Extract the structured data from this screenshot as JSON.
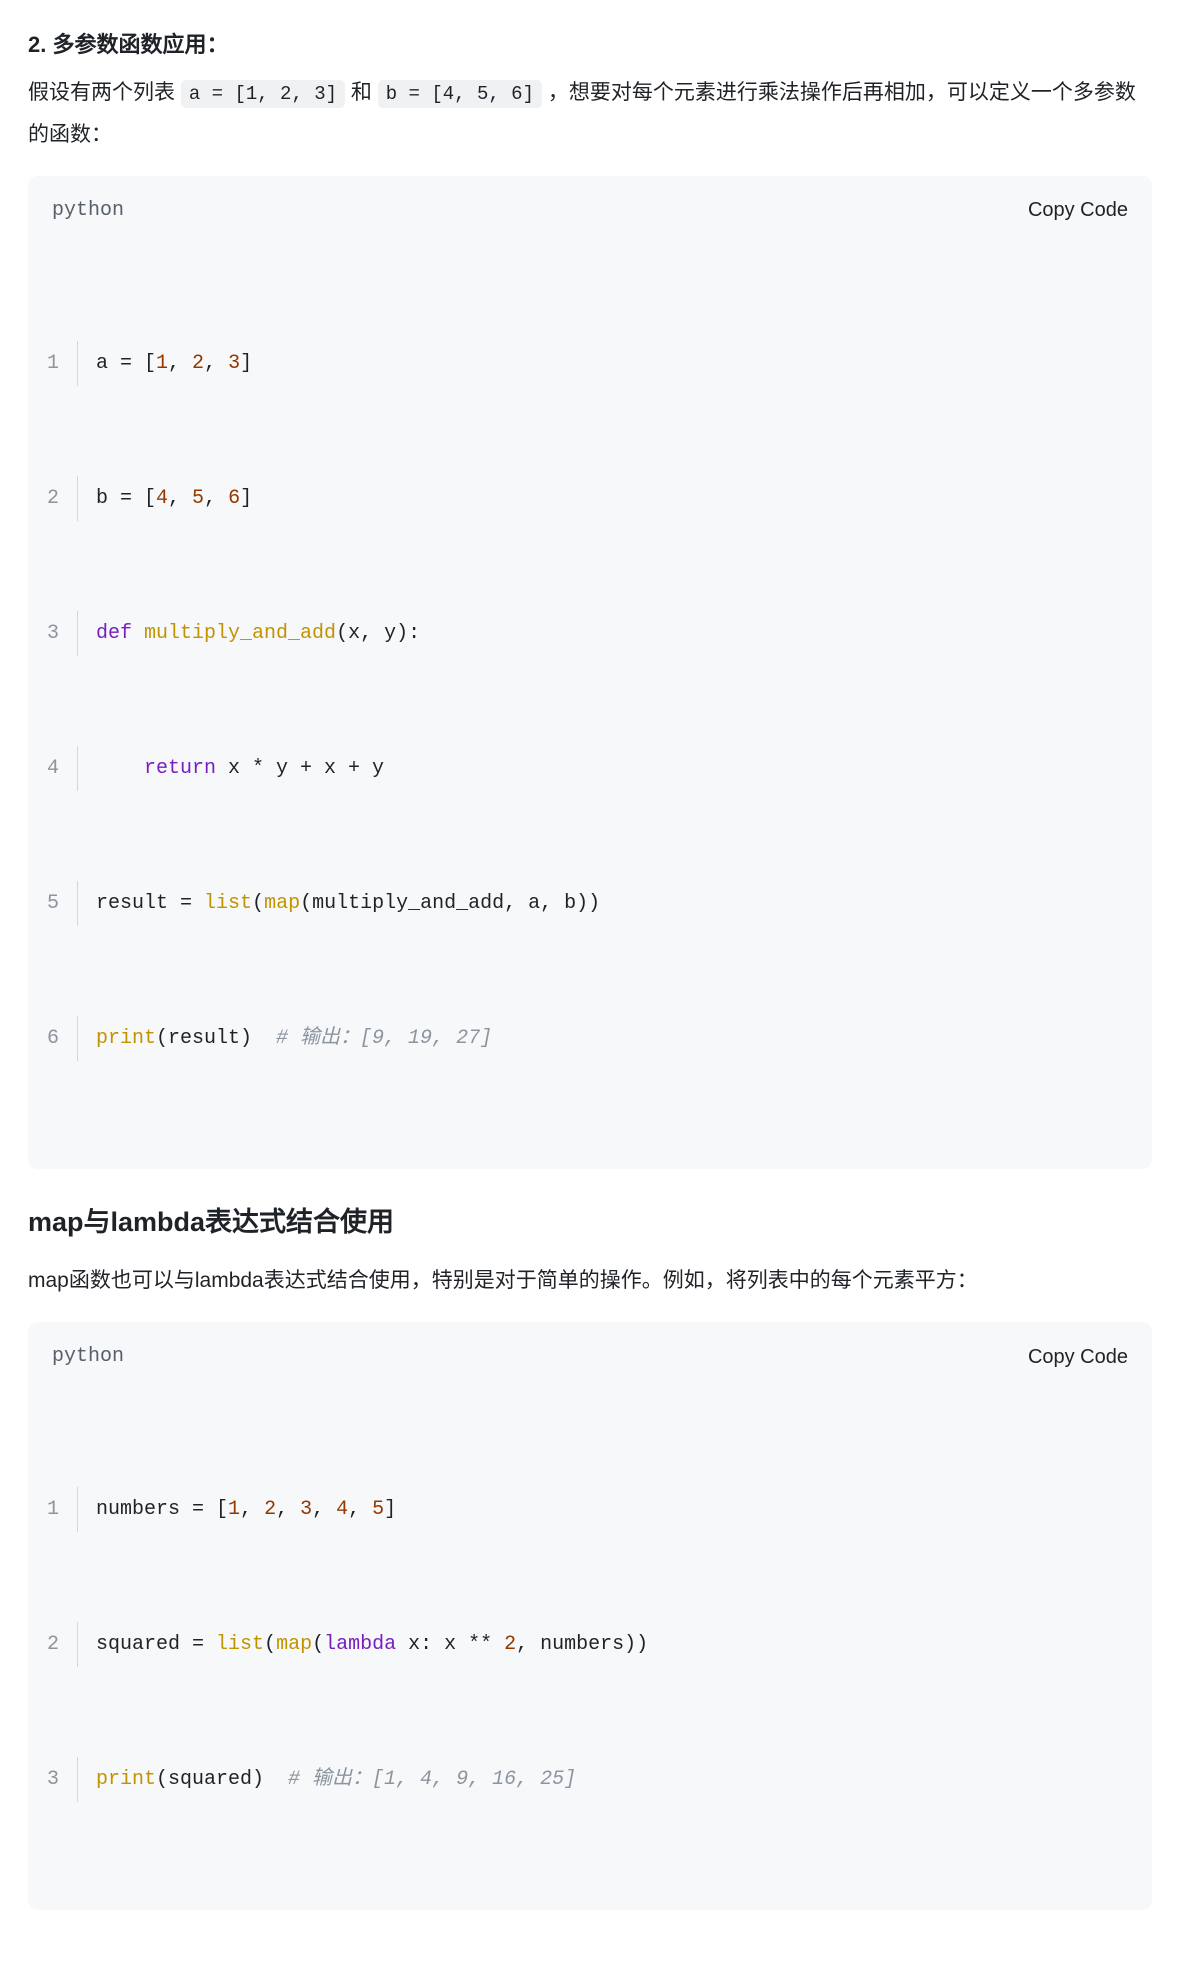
{
  "section1": {
    "title": "2. 多参数函数应用：",
    "para_before": "假设有两个列表 ",
    "inline_a": "a = [1, 2, 3]",
    "para_mid1": " 和 ",
    "inline_b": "b = [4, 5, 6]",
    "para_after": " ，想要对每个元素进行乘法操作后再相加，可以定义一个多参数的函数："
  },
  "codeblock1": {
    "lang": "python",
    "copy": "Copy Code",
    "lines": {
      "l1": {
        "n": "1",
        "a1": "a = [",
        "n1": "1",
        "c1": ", ",
        "n2": "2",
        "c2": ", ",
        "n3": "3",
        "a2": "]"
      },
      "l2": {
        "n": "2",
        "a1": "b = [",
        "n1": "4",
        "c1": ", ",
        "n2": "5",
        "c2": ", ",
        "n3": "6",
        "a2": "]"
      },
      "l3": {
        "n": "3",
        "kw": "def",
        "sp": " ",
        "fn": "multiply_and_add",
        "rest": "(x, y):"
      },
      "l4": {
        "n": "4",
        "indent": "    ",
        "kw": "return",
        "rest": " x * y + x + y"
      },
      "l5": {
        "n": "5",
        "pre": "result = ",
        "f1": "list",
        "p1": "(",
        "f2": "map",
        "rest": "(multiply_and_add, a, b))"
      },
      "l6": {
        "n": "6",
        "f1": "print",
        "rest": "(result)  ",
        "cmt": "# 输出：[9, 19, 27]"
      }
    }
  },
  "section2": {
    "heading": "map与lambda表达式结合使用",
    "para": "map函数也可以与lambda表达式结合使用，特别是对于简单的操作。例如，将列表中的每个元素平方："
  },
  "codeblock2": {
    "lang": "python",
    "copy": "Copy Code",
    "lines": {
      "l1": {
        "n": "1",
        "a1": "numbers = [",
        "n1": "1",
        "c1": ", ",
        "n2": "2",
        "c2": ", ",
        "n3": "3",
        "c3": ", ",
        "n4": "4",
        "c4": ", ",
        "n5": "5",
        "a2": "]"
      },
      "l2": {
        "n": "2",
        "pre": "squared = ",
        "f1": "list",
        "p1": "(",
        "f2": "map",
        "p2": "(",
        "kw": "lambda",
        "mid": " x: x ** ",
        "num": "2",
        "rest": ", numbers))"
      },
      "l3": {
        "n": "3",
        "f1": "print",
        "rest": "(squared)  ",
        "cmt": "# 输出：[1, 4, 9, 16, 25]"
      }
    }
  }
}
